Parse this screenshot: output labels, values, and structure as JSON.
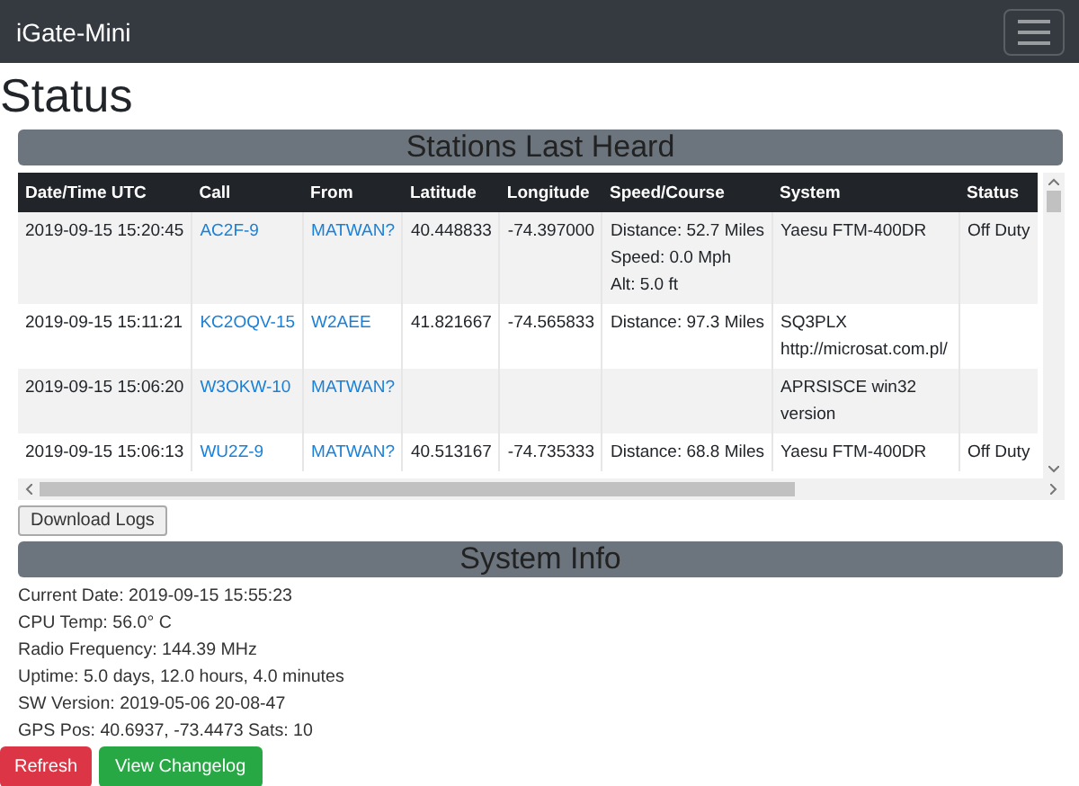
{
  "navbar": {
    "brand": "iGate-Mini"
  },
  "title": "Status",
  "stations": {
    "heading": "Stations Last Heard",
    "columns": [
      "Date/Time UTC",
      "Call",
      "From",
      "Latitude",
      "Longitude",
      "Speed/Course",
      "System",
      "Status"
    ],
    "rows": [
      {
        "time": "2019-09-15 15:20:45",
        "call": "AC2F-9",
        "from": "MATWAN?",
        "latitude": "40.448833",
        "longitude": "-74.397000",
        "speed_course": [
          "Distance: 52.7 Miles",
          "Speed: 0.0 Mph",
          "Alt: 5.0 ft"
        ],
        "system": [
          "Yaesu FTM-400DR"
        ],
        "status": "Off Duty"
      },
      {
        "time": "2019-09-15 15:11:21",
        "call": "KC2OQV-15",
        "from": "W2AEE",
        "latitude": "41.821667",
        "longitude": "-74.565833",
        "speed_course": [
          "Distance: 97.3 Miles"
        ],
        "system": [
          "SQ3PLX",
          "http://microsat.com.pl/"
        ]
      },
      {
        "time": "2019-09-15 15:06:20",
        "call": "W3OKW-10",
        "from": "MATWAN?",
        "system": [
          "APRSISCE win32 version"
        ]
      },
      {
        "time": "2019-09-15 15:06:13",
        "call": "WU2Z-9",
        "from": "MATWAN?",
        "latitude": "40.513167",
        "longitude": "-74.735333",
        "speed_course": [
          "Distance: 68.8 Miles"
        ],
        "system": [
          "Yaesu FTM-400DR"
        ],
        "status": "Off Duty"
      }
    ],
    "download_button": "Download Logs"
  },
  "system_info": {
    "heading": "System Info",
    "lines": [
      "Current Date: 2019-09-15 15:55:23",
      "CPU Temp: 56.0° C",
      "Radio Frequency: 144.39 MHz",
      "Uptime: 5.0 days, 12.0 hours, 4.0 minutes",
      "SW Version: 2019-05-06 20-08-47",
      "GPS Pos: 40.6937, -73.4473 Sats: 10"
    ]
  },
  "buttons": [
    {
      "label": "Refresh",
      "kind": "danger"
    },
    {
      "label": "View Changelog",
      "kind": "success"
    }
  ]
}
